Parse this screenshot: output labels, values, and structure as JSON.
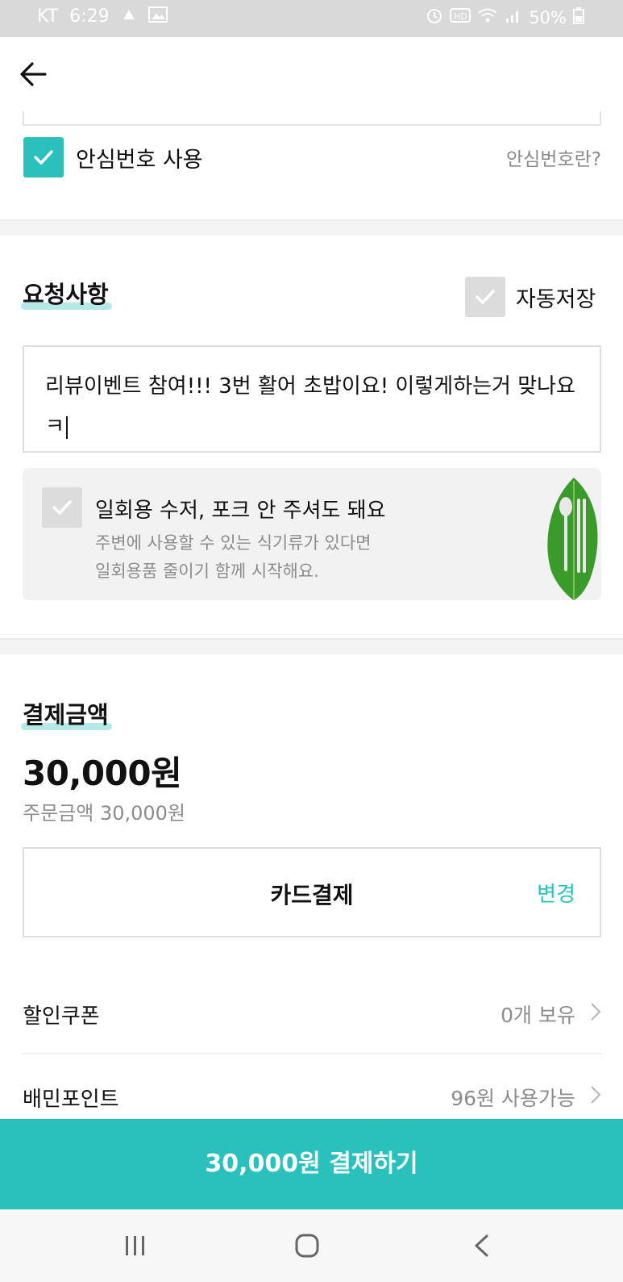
{
  "status_bar": {
    "carrier": "KT",
    "time": "6:29",
    "battery": "50%",
    "icons": [
      "notification-icon",
      "gallery-icon",
      "alarm-icon",
      "hd-icon",
      "wifi-icon",
      "signal-icon",
      "battery-icon"
    ]
  },
  "header": {
    "back_icon": "arrow-left-icon"
  },
  "safe_number": {
    "label": "안심번호 사용",
    "checked": true,
    "help_link": "안심번호란?"
  },
  "request": {
    "title": "요청사항",
    "autosave_label": "자동저장",
    "autosave_checked": false,
    "text": "리뷰이벤트 참여!!! 3번 활어 초밥이요! 이렇게하는거 맞나요 ㅋ"
  },
  "eco": {
    "checked": false,
    "title": "일회용 수저, 포크 안 주셔도 돼요",
    "line1": "주변에 사용할 수 있는 식기류가 있다면",
    "line2": "일회용품 줄이기 함께 시작해요.",
    "image": "leaf-cutlery-icon"
  },
  "payment": {
    "title": "결제금액",
    "amount": "30,000원",
    "order_amount": "주문금액 30,000원",
    "method": "카드결제",
    "change_label": "변경",
    "rows": [
      {
        "label": "할인쿠폰",
        "value": "0개 보유"
      },
      {
        "label": "배민포인트",
        "value": "96원 사용가능"
      }
    ],
    "submit_label": "30,000원 결제하기"
  },
  "colors": {
    "accent": "#2ac1bc",
    "muted_text": "#8c8c8c",
    "unchecked_box": "#dcdcdc"
  },
  "nav": {
    "icons": [
      "recent-apps-icon",
      "home-icon",
      "back-icon"
    ]
  }
}
